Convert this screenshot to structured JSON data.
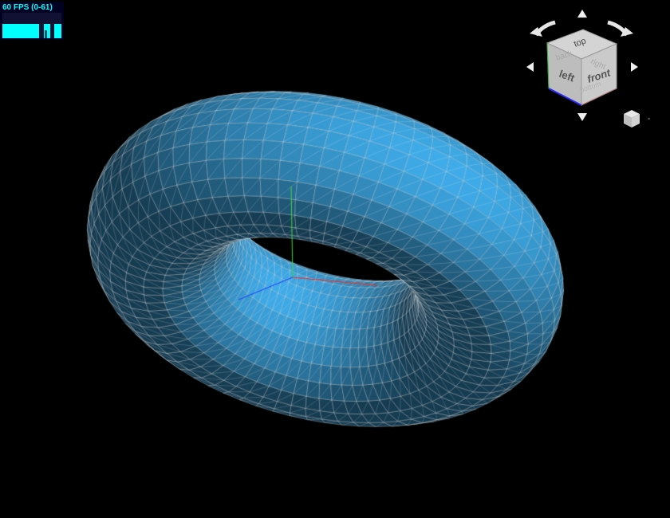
{
  "fps_meter": {
    "label": "60 FPS (0-61)"
  },
  "navcube": {
    "faces": {
      "top": "top",
      "front": "front",
      "left": "left",
      "back": "back",
      "right": "right",
      "bottom": "bottom"
    },
    "icons": [
      "rotate-left-icon",
      "rotate-right-icon",
      "arrow-up-icon",
      "arrow-down-icon",
      "arrow-left-icon",
      "arrow-right-icon",
      "home-cube-icon"
    ]
  },
  "scene": {
    "object": "torus",
    "surface_color": "#3a9fd8",
    "wireframe_color": "#ffffff",
    "background": "#000000",
    "axes": {
      "x_color": "#ff2a1a",
      "y_color": "#3adf3a",
      "z_color": "#1a3aff"
    }
  }
}
